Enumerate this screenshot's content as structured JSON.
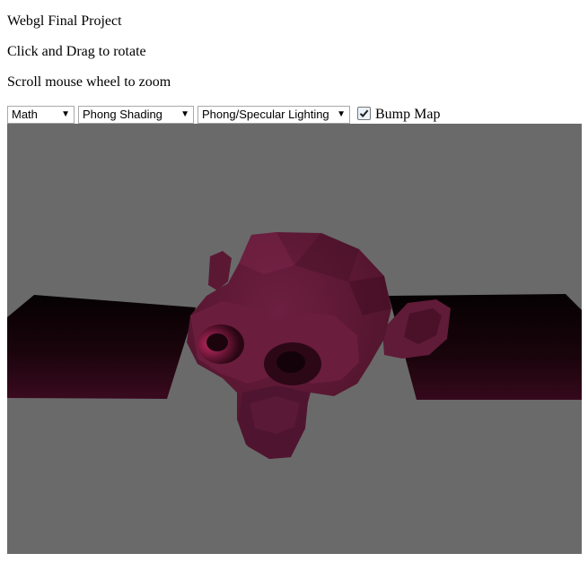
{
  "header": {
    "title": "Webgl Final Project",
    "instruction_rotate": "Click and Drag to rotate",
    "instruction_zoom": "Scroll mouse wheel to zoom"
  },
  "controls": {
    "model_select": {
      "value": "Math"
    },
    "shading_select": {
      "value": "Phong Shading"
    },
    "lighting_select": {
      "value": "Phong/Specular Lighting"
    },
    "bump_map": {
      "label": "Bump Map",
      "checked": true
    }
  },
  "viewport": {
    "background_color": "#6a6a6a",
    "model_color": "#5e1a36",
    "plane_color": "#1a040c"
  },
  "icons": [
    "dropdown-arrow-icon",
    "checkmark-icon"
  ]
}
